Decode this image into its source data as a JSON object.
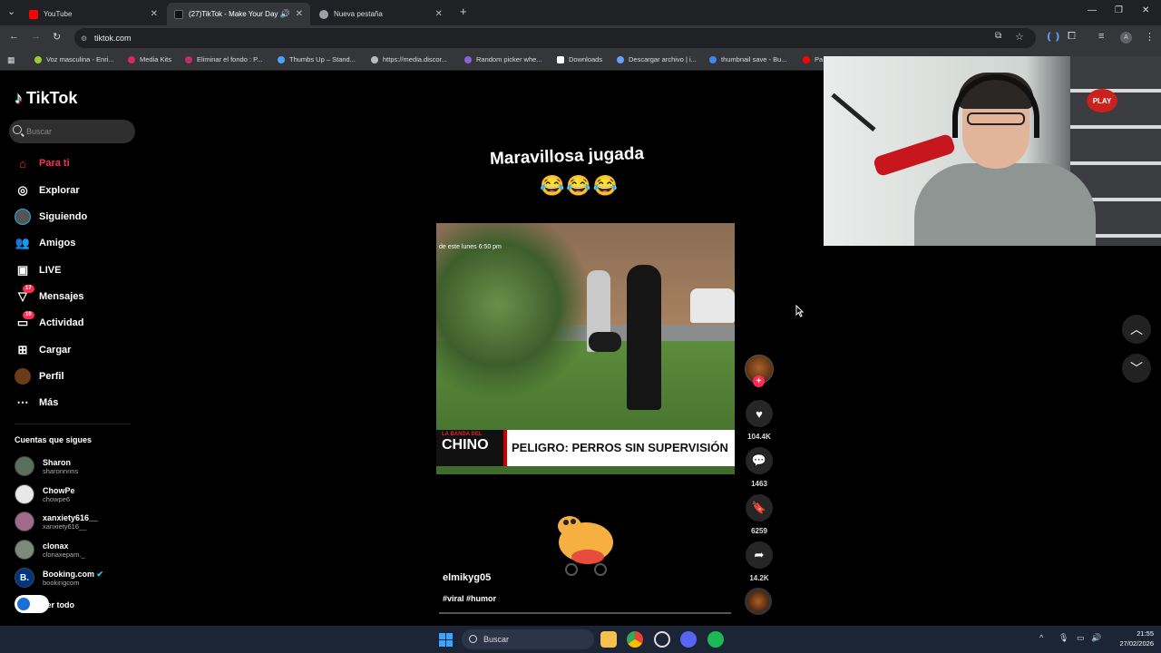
{
  "browser": {
    "tabs": [
      {
        "title": "YouTube",
        "favicon_color": "#ff0000"
      },
      {
        "title": "(27)TikTok - Make Your Day",
        "favicon_color": "#000000"
      },
      {
        "title": "Nueva pestaña",
        "favicon_color": "#9aa0a6"
      }
    ],
    "url": "tiktok.com",
    "bookmarks": [
      {
        "label": "Voz masculina - Enri...",
        "color": "#9acd32"
      },
      {
        "label": "Media Kits",
        "color": "#e0245e"
      },
      {
        "label": "Eliminar el fondo : P...",
        "color": "#c12d6b"
      },
      {
        "label": "Thumbs Up – Stand...",
        "color": "#4aa3ff"
      },
      {
        "label": "https://media.discor...",
        "color": "#bbbbbb"
      },
      {
        "label": "Random picker whe...",
        "color": "#8a63d2"
      },
      {
        "label": "Downloads",
        "color": "#ffffff"
      },
      {
        "label": "Descargar archivo | i...",
        "color": "#6aa0ff"
      },
      {
        "label": "thumbnail save - Bu...",
        "color": "#4285f4"
      },
      {
        "label": "Pa",
        "color": "#ff0000"
      }
    ]
  },
  "sidebar": {
    "logo": "TikTok",
    "search_placeholder": "Buscar",
    "nav": [
      {
        "label": "Para ti",
        "icon": "home-icon",
        "badge": ""
      },
      {
        "label": "Explorar",
        "icon": "compass-icon",
        "badge": ""
      },
      {
        "label": "Siguiendo",
        "icon": "following-icon",
        "badge": ""
      },
      {
        "label": "Amigos",
        "icon": "friends-icon",
        "badge": ""
      },
      {
        "label": "LIVE",
        "icon": "live-icon",
        "badge": ""
      },
      {
        "label": "Mensajes",
        "icon": "messages-icon",
        "badge": "17"
      },
      {
        "label": "Actividad",
        "icon": "activity-icon",
        "badge": "10"
      },
      {
        "label": "Cargar",
        "icon": "upload-icon",
        "badge": ""
      },
      {
        "label": "Perfil",
        "icon": "profile-icon",
        "badge": ""
      },
      {
        "label": "Más",
        "icon": "more-icon",
        "badge": ""
      }
    ],
    "following_title": "Cuentas que sigues",
    "accounts": [
      {
        "name": "Sharon",
        "username": "sharonnnns"
      },
      {
        "name": "ChowPe",
        "username": "chowpe6"
      },
      {
        "name": "xanxiety616__",
        "username": "xanxiety616__"
      },
      {
        "name": "clonax",
        "username": "clonaxepam._"
      },
      {
        "name": "Booking.com",
        "username": "bookingcom"
      }
    ],
    "see_all": "Ver todo"
  },
  "video": {
    "caption_title": "Maravillosa jugada",
    "caption_emojis": "😂😂😂",
    "timestamp_overlay": "de este lunes 6:50 pm",
    "lower_third_brand": "CHINO",
    "lower_third_brand_top": "LA BANDA DEL",
    "lower_third_text": "PELIGRO: PERROS SIN SUPERVISIÓN",
    "author": "elmikyg05",
    "hashtags": "#viral #humor"
  },
  "actions": {
    "likes": "104.4K",
    "comments": "1463",
    "saves": "6259",
    "shares": "14.2K"
  },
  "webcam": {
    "sign": "PLAY"
  },
  "taskbar": {
    "search_placeholder": "Buscar",
    "time": "21:55",
    "date": "27/02/2026"
  }
}
